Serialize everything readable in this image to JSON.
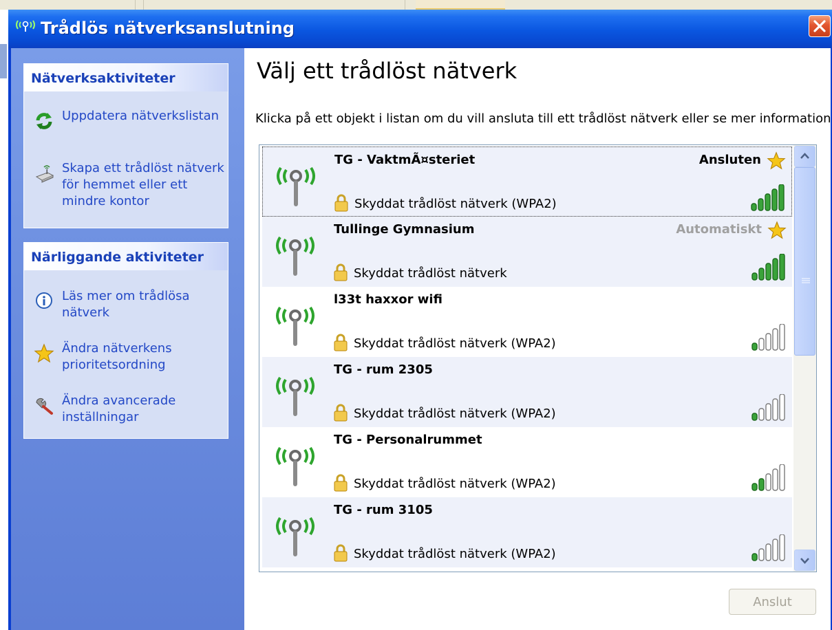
{
  "window": {
    "title": "Trådlös nätverksanslutning",
    "icon": "wireless-network-icon",
    "close_icon": "close-icon",
    "accent_color": "#0a56e0",
    "close_color": "#e2552e"
  },
  "sidebar": {
    "network_tasks": {
      "header": "Nätverksaktiviteter",
      "items": [
        {
          "label": "Uppdatera nätverkslistan",
          "icon": "refresh-icon"
        },
        {
          "label": "Skapa ett trådlöst nätverk för hemmet eller ett mindre kontor",
          "icon": "wireless-setup-icon"
        }
      ]
    },
    "related_tasks": {
      "header": "Närliggande aktiviteter",
      "items": [
        {
          "label": "Läs mer om trådlösa nätverk",
          "icon": "info-icon"
        },
        {
          "label": "Ändra nätverkens prioritetsordning",
          "icon": "star-icon"
        },
        {
          "label": "Ändra avancerade inställningar",
          "icon": "wrench-icon"
        }
      ]
    }
  },
  "main": {
    "title": "Välj ett trådlöst nätverk",
    "description": "Klicka på ett objekt i listan om du vill ansluta till ett trådlöst nätverk eller se mer information.",
    "networks": [
      {
        "name": "TG - VaktmÃ¤steriet",
        "status": "Ansluten",
        "security": "Skyddat trådlöst nätverk (WPA2)",
        "signal_bars": 5,
        "selected": true
      },
      {
        "name": "Tullinge Gymnasium",
        "status": "Automatiskt",
        "security": "Skyddat trådlöst nätverk",
        "signal_bars": 5,
        "selected": false
      },
      {
        "name": "l33t haxxor wifi",
        "status": "",
        "security": "Skyddat trådlöst nätverk (WPA2)",
        "signal_bars": 1,
        "selected": false
      },
      {
        "name": "TG - rum 2305",
        "status": "",
        "security": "Skyddat trådlöst nätverk (WPA2)",
        "signal_bars": 1,
        "selected": false
      },
      {
        "name": "TG - Personalrummet",
        "status": "",
        "security": "Skyddat trådlöst nätverk (WPA2)",
        "signal_bars": 2,
        "selected": false
      },
      {
        "name": "TG - rum 3105",
        "status": "",
        "security": "Skyddat trådlöst nätverk (WPA2)",
        "signal_bars": 1,
        "selected": false
      }
    ],
    "connect_button": "Anslut"
  }
}
